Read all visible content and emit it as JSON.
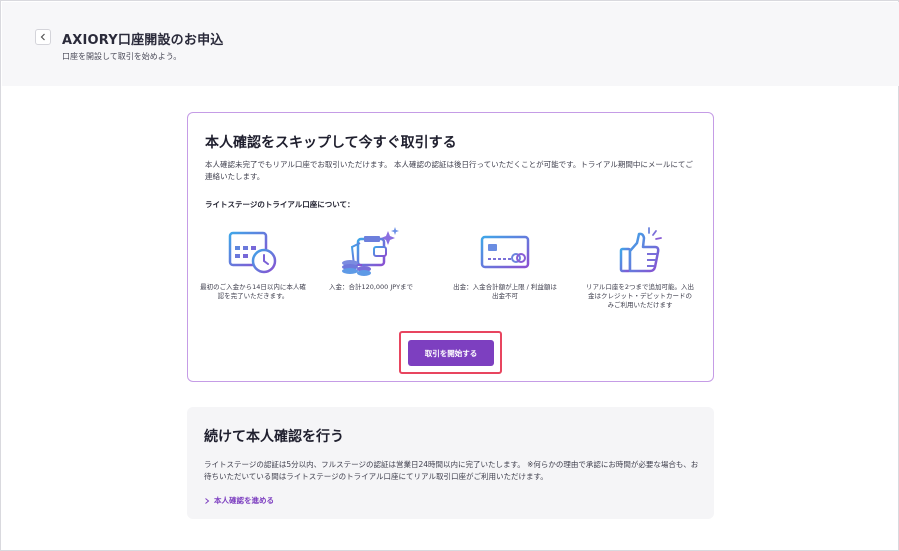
{
  "header": {
    "title": "AXIORY口座開設のお申込",
    "subtitle": "口座を開設して取引を始めよう。"
  },
  "skip_card": {
    "title": "本人確認をスキップして今すぐ取引する",
    "description": "本人確認未完了でもリアル口座でお取引いただけます。 本人確認の認証は後日行っていただくことが可能です。トライアル期間中にメールにてご連絡いたします。",
    "section_label": "ライトステージのトライアル口座について：",
    "features": [
      {
        "icon": "calendar-clock-icon",
        "caption": "最初のご入金から14日以内に本人確認を完了いただきます。"
      },
      {
        "icon": "wallet-coins-icon",
        "caption": "入金：合計120,000 JPYまで"
      },
      {
        "icon": "credit-card-icon",
        "caption": "出金：入金合計額が上限 / 利益額は出金不可"
      },
      {
        "icon": "thumbs-up-icon",
        "caption": "リアル口座を2つまで追加可能。入出金はクレジット・デビットカードのみご利用いただけます"
      }
    ],
    "start_button": "取引を開始する"
  },
  "verify_card": {
    "title": "続けて本人確認を行う",
    "description": "ライトステージの認証は5分以内、フルステージの認証は営業日24時間以内に完了いたします。 ※何らかの理由で承認にお時間が必要な場合も、お待ちいただいている間はライトステージのトライアル口座にてリアル取引口座がご利用いただけます。",
    "link": "本人確認を進める"
  },
  "colors": {
    "accent": "#7d3fc0",
    "card_border": "#c59ce6",
    "highlight": "#e8455f",
    "icon_gradient_start": "#3fa6e8",
    "icon_gradient_end": "#8a4fd1"
  }
}
